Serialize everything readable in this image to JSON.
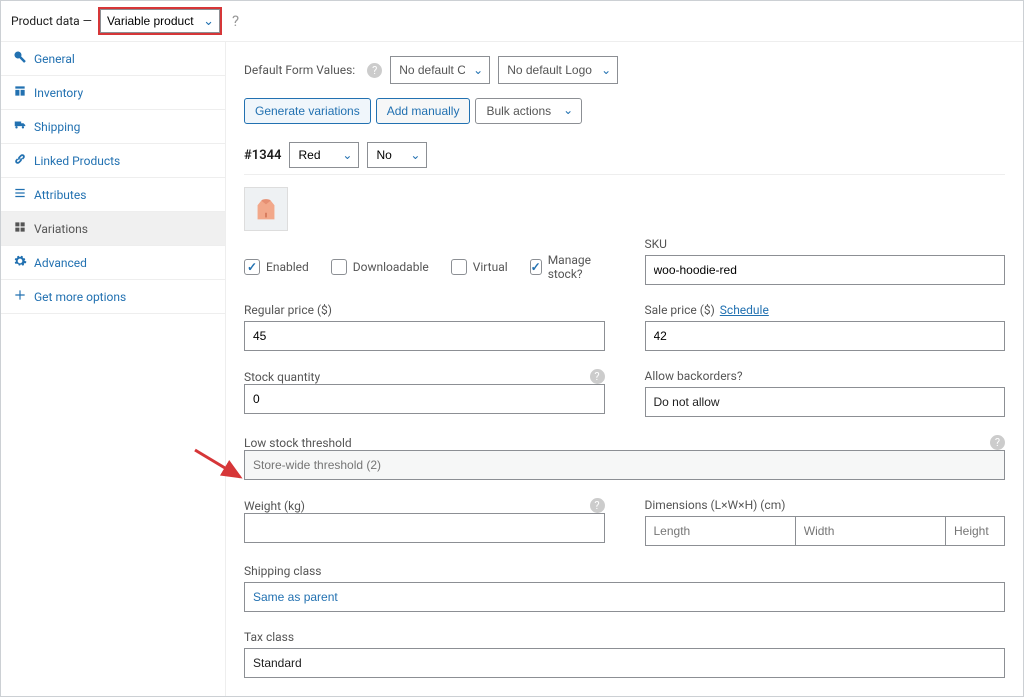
{
  "topbar": {
    "label": "Product data —",
    "product_type": "Variable product"
  },
  "tabs": [
    {
      "id": "general",
      "label": "General",
      "icon": "tool"
    },
    {
      "id": "inventory",
      "label": "Inventory",
      "icon": "inventory"
    },
    {
      "id": "shipping",
      "label": "Shipping",
      "icon": "shipping"
    },
    {
      "id": "linked",
      "label": "Linked Products",
      "icon": "link"
    },
    {
      "id": "attributes",
      "label": "Attributes",
      "icon": "list"
    },
    {
      "id": "variations",
      "label": "Variations",
      "icon": "variations",
      "active": true
    },
    {
      "id": "advanced",
      "label": "Advanced",
      "icon": "gear"
    },
    {
      "id": "getmore",
      "label": "Get more options",
      "icon": "plus"
    }
  ],
  "defaults": {
    "label": "Default Form Values:",
    "color": "No default Color…",
    "logo": "No default Logo…"
  },
  "buttons": {
    "generate": "Generate variations",
    "add_manual": "Add manually",
    "bulk": "Bulk actions"
  },
  "variation": {
    "id": "#1344",
    "attr_color": "Red",
    "attr_logo": "No",
    "checks": {
      "enabled": {
        "label": "Enabled",
        "value": true
      },
      "downloadable": {
        "label": "Downloadable",
        "value": false
      },
      "virtual": {
        "label": "Virtual",
        "value": false
      },
      "manage_stock": {
        "label": "Manage stock?",
        "value": true
      }
    },
    "sku": {
      "label": "SKU",
      "value": "woo-hoodie-red"
    },
    "regular_price": {
      "label": "Regular price ($)",
      "value": "45"
    },
    "sale_price": {
      "label": "Sale price ($)",
      "schedule": "Schedule",
      "value": "42"
    },
    "stock_qty": {
      "label": "Stock quantity",
      "value": "0"
    },
    "backorders": {
      "label": "Allow backorders?",
      "value": "Do not allow"
    },
    "low_stock": {
      "label": "Low stock threshold",
      "placeholder": "Store-wide threshold (2)"
    },
    "weight": {
      "label": "Weight (kg)",
      "value": ""
    },
    "dimensions": {
      "label": "Dimensions (L×W×H) (cm)",
      "l": "Length",
      "w": "Width",
      "h": "Height"
    },
    "shipping_class": {
      "label": "Shipping class",
      "value": "Same as parent"
    },
    "tax_class": {
      "label": "Tax class",
      "value": "Standard"
    }
  },
  "annotations": {
    "highlight_product_type": true,
    "arrow_to_shipping_class": true
  }
}
